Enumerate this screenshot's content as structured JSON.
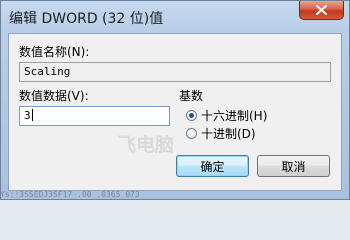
{
  "dialog": {
    "title": "编辑 DWORD (32 位)值",
    "close_icon": "close-icon",
    "close_color": "#c2381e"
  },
  "value_name": {
    "label": "数值名称(N):",
    "value": "Scaling"
  },
  "value_data": {
    "label": "数值数据(V):",
    "value": "3"
  },
  "base": {
    "label": "基数",
    "options": [
      {
        "label": "十六进制(H)",
        "checked": true
      },
      {
        "label": "十进制(D)",
        "checked": false
      }
    ]
  },
  "buttons": {
    "ok_label": "确定",
    "cancel_label": "取消"
  },
  "watermark": "飞电脑",
  "bottom_strip": "Ys:!3SSEDJ3SF17 .00 .0365 073"
}
